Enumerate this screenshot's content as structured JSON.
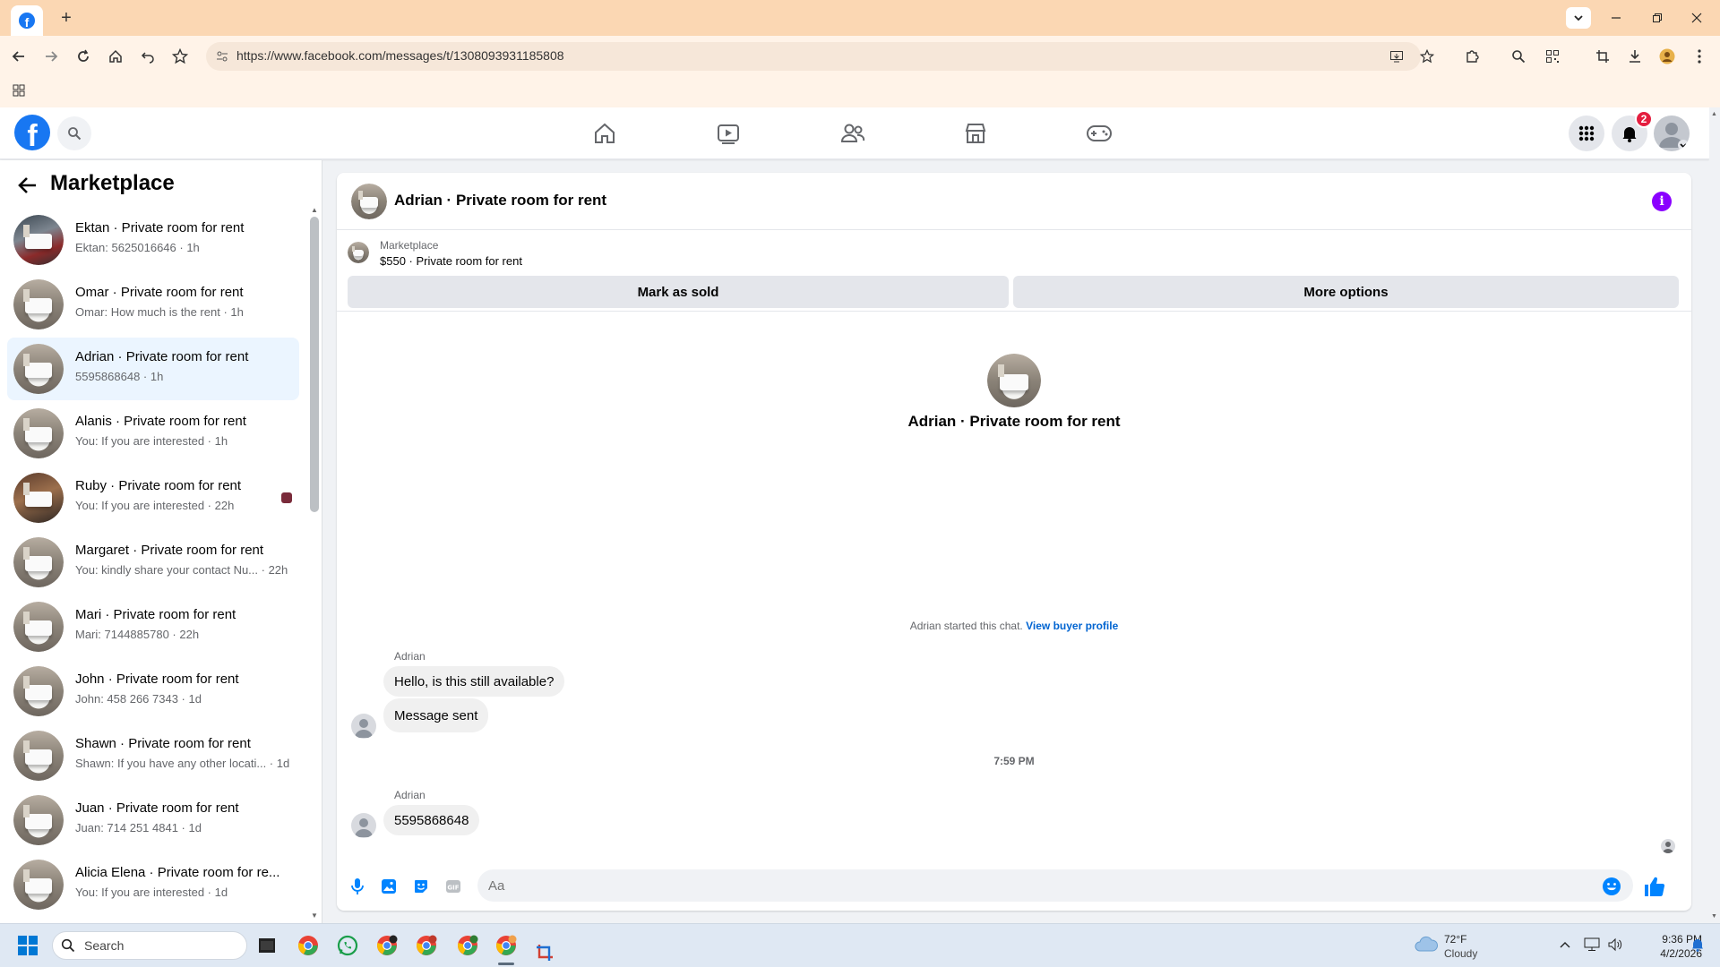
{
  "browser": {
    "url": "https://www.facebook.com/messages/t/1308093931185808"
  },
  "fb_header": {
    "notification_count": "2"
  },
  "sidebar": {
    "title": "Marketplace",
    "conversations": [
      {
        "name": "Ektan · Private room for rent",
        "preview": "Ektan: 5625016646 · 1h"
      },
      {
        "name": "Omar · Private room for rent",
        "preview": "Omar: How much is the rent · 1h"
      },
      {
        "name": "Adrian · Private room for rent",
        "preview": "5595868648 · 1h"
      },
      {
        "name": "Alanis · Private room for rent",
        "preview": "You: If you are interested · 1h"
      },
      {
        "name": "Ruby · Private room for rent",
        "preview": "You: If you are interested · 22h"
      },
      {
        "name": "Margaret · Private room for rent",
        "preview": "You: kindly share your contact Nu... · 22h"
      },
      {
        "name": "Mari · Private room for rent",
        "preview": "Mari: 7144885780 · 22h"
      },
      {
        "name": "John · Private room for rent",
        "preview": "John: 458 266 7343 · 1d"
      },
      {
        "name": "Shawn · Private room for rent",
        "preview": "Shawn: If you have any other locati... · 1d"
      },
      {
        "name": "Juan · Private room for rent",
        "preview": "Juan: 714 251 4841 · 1d"
      },
      {
        "name": "Alicia Elena · Private room for re...",
        "preview": "You: If you are interested · 1d"
      }
    ]
  },
  "chat": {
    "title": "Adrian · Private room for rent",
    "marketplace_label": "Marketplace",
    "listing": "$550 · Private room for rent",
    "mark_sold_label": "Mark as sold",
    "more_options_label": "More options",
    "center_title": "Adrian · Private room for rent",
    "started_text": "Adrian started this chat.",
    "view_profile_link": "View buyer profile",
    "sender_1": "Adrian",
    "message_1": "Hello, is this still available?",
    "message_2": "Message sent",
    "timestamp": "7:59 PM",
    "sender_2": "Adrian",
    "message_3": "5595868648",
    "input_placeholder": "Aa"
  },
  "taskbar": {
    "search_label": "Search",
    "weather_temp": "72°F",
    "weather_desc": "Cloudy",
    "time": "9:36 PM",
    "date": "4/2/2026"
  },
  "colors": {
    "facebook_blue": "#1877f2",
    "messenger_blue": "#0084ff",
    "info_purple": "#8a00ff",
    "active_conversation": "#ebf5ff",
    "browser_tabbar": "#fbd7b3"
  }
}
